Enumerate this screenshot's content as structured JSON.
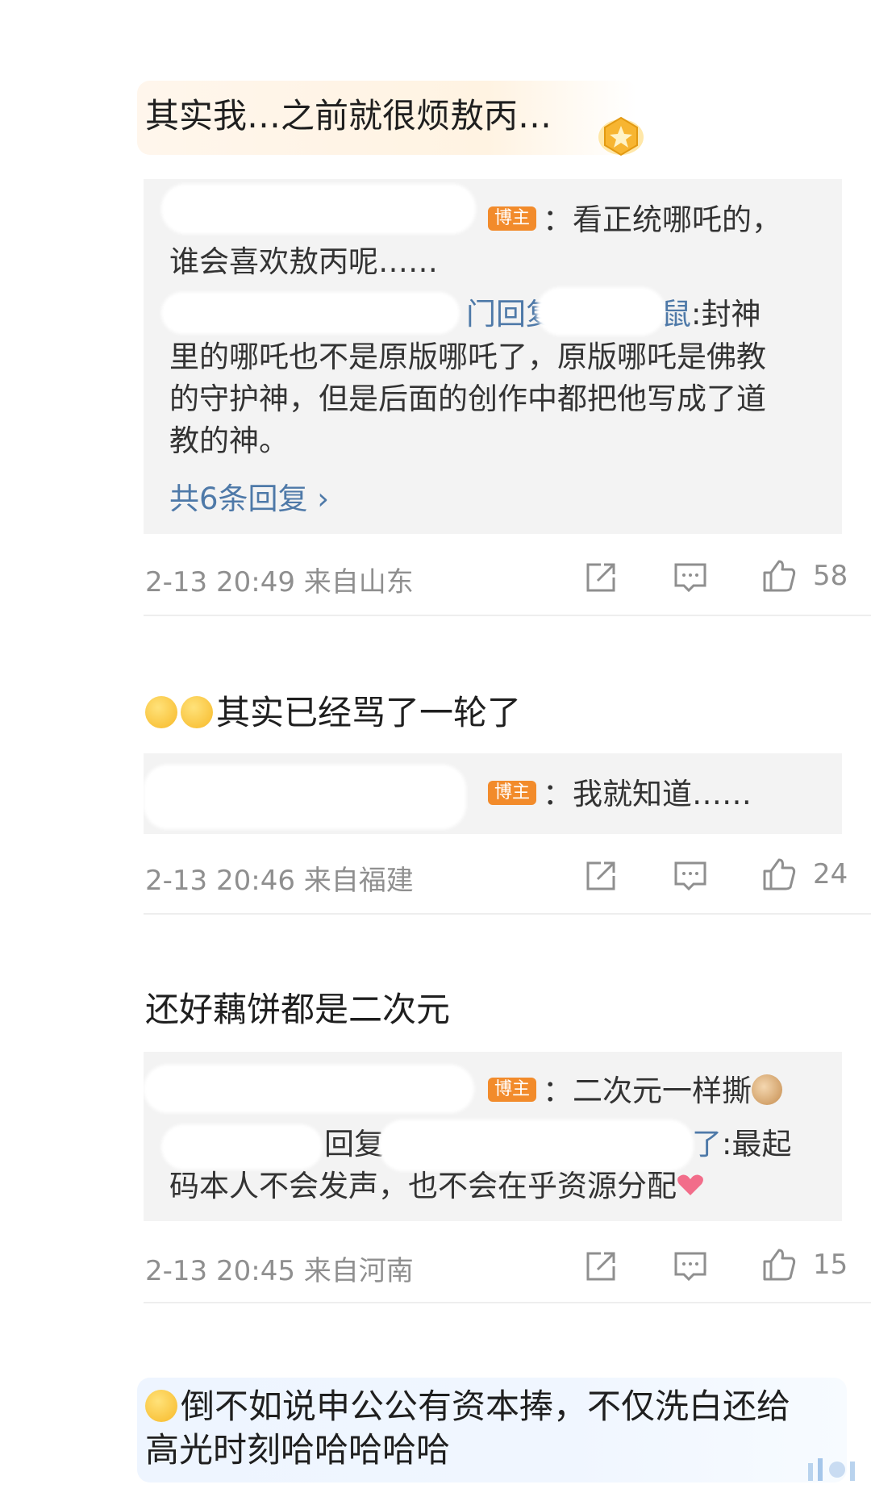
{
  "comments": [
    {
      "text": "其实我…之前就很烦敖丙…",
      "replies": [
        {
          "tag": "博主",
          "line1": "：看正统哪吒的，",
          "line2": "谁会喜欢敖丙呢……"
        },
        {
          "prefix_tail": "门回复",
          "target_tail": "鼠",
          "l1": ":封神",
          "l2": "里的哪吒也不是原版哪吒了，原版哪吒是佛教",
          "l3": "的守护神，但是后面的创作中都把他写成了道",
          "l4": "教的神。"
        }
      ],
      "more": "共6条回复 ›",
      "time": "2-13 20:49",
      "location": "来自山东",
      "likes": "58"
    },
    {
      "text": "其实已经骂了一轮了",
      "replies": [
        {
          "tag": "博主",
          "line1": "：我就知道……"
        }
      ],
      "time": "2-13 20:46",
      "location": "来自福建",
      "likes": "24"
    },
    {
      "text": "还好藕饼都是二次元",
      "replies": [
        {
          "tag": "博主",
          "line1": "：二次元一样撕"
        },
        {
          "l1a": "回复",
          "l1b": "了",
          "l1c": ":最起",
          "l2": "码本人不会发声，也不会在乎资源分配"
        }
      ],
      "time": "2-13 20:45",
      "location": "来自河南",
      "likes": "15"
    },
    {
      "text_l1": "倒不如说申公公有资本捧，不仅洗白还给",
      "text_l2": "高光时刻哈哈哈哈哈"
    }
  ],
  "icons": [
    "share-icon",
    "comment-icon",
    "thumbs-up-icon",
    "smile-emoji",
    "laugh-emoji",
    "cat-emoji",
    "heart-emoji",
    "vip-badge-icon"
  ]
}
